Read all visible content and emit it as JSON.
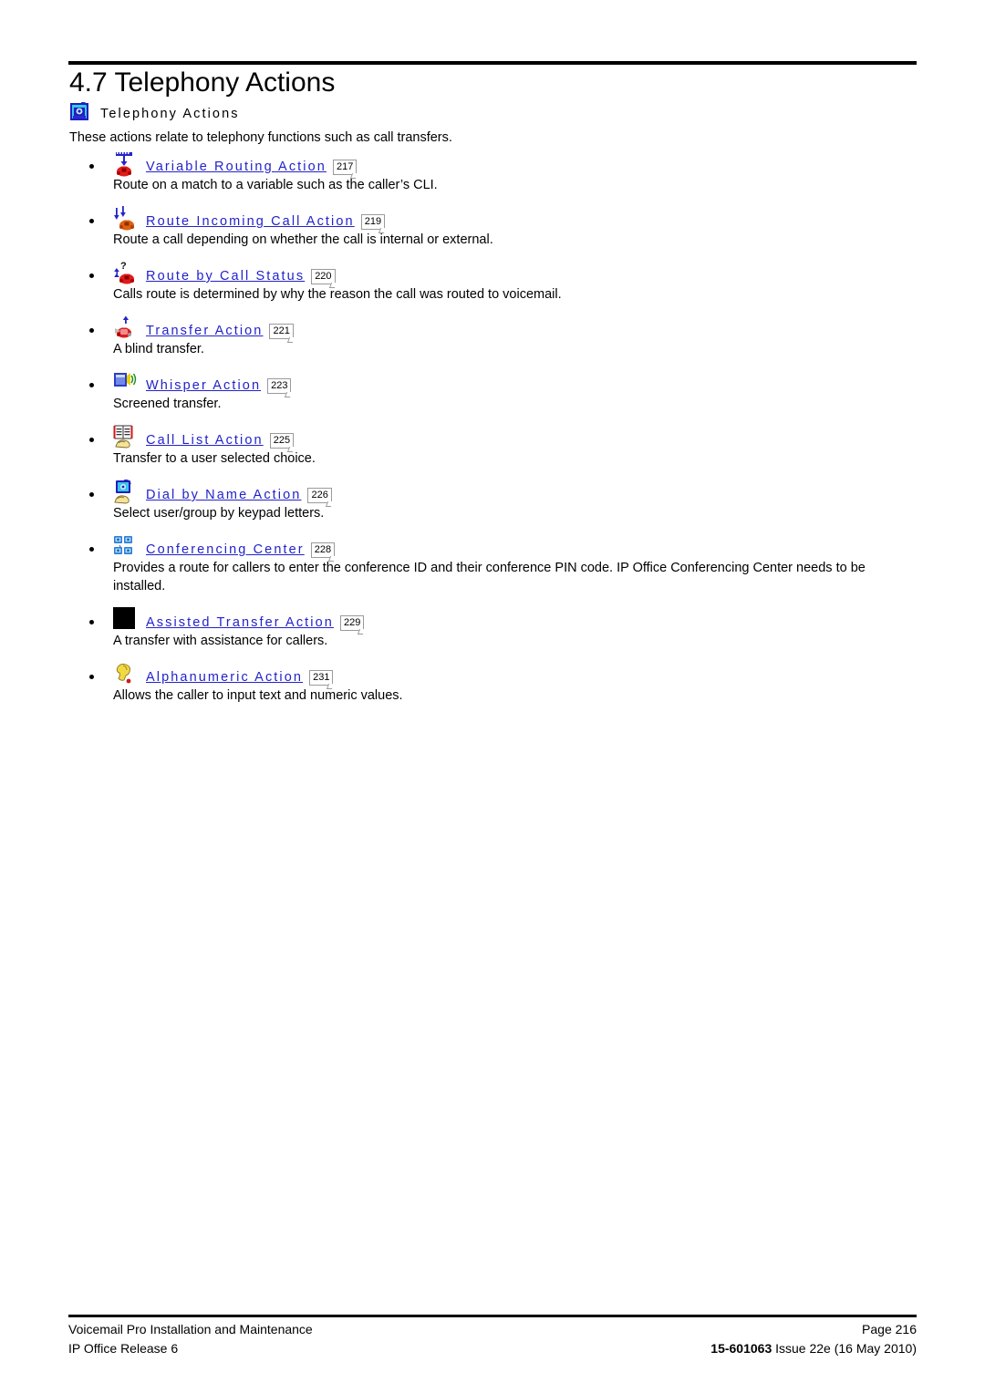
{
  "document": {
    "section_number": "4.7",
    "section_title": "4.7 Telephony Actions",
    "intro_heading": "Telephony Actions",
    "intro_heading_icon": "blue-telephone-icon",
    "intro_text": "These actions relate to telephony functions such as call transfers."
  },
  "actions": [
    {
      "icon": "red-telephone-with-down-arrow-and-ruler-icon",
      "label": "Variable Routing Action",
      "page_ref": "217",
      "description": "Route on a match to a variable such as the caller’s CLI."
    },
    {
      "icon": "blue-arrows-with-orange-telephone-icon",
      "label": "Route Incoming Call Action",
      "page_ref": "219",
      "description": "Route a call depending on whether the call is internal or external."
    },
    {
      "icon": "blue-arrows-question-mark-telephone-icon",
      "label": "Route by Call Status",
      "page_ref": "220",
      "description": "Calls route is determined by why the reason the call was routed to voicemail."
    },
    {
      "icon": "red-telephone-transfer-icon",
      "label": "Transfer Action",
      "page_ref": "221",
      "description": "A blind transfer."
    },
    {
      "icon": "whisper-speaker-icon",
      "label": "Whisper Action",
      "page_ref": "223",
      "description": "Screened transfer."
    },
    {
      "icon": "call-list-book-hand-icon",
      "label": "Call List Action",
      "page_ref": "225",
      "description": "Transfer to a user selected choice."
    },
    {
      "icon": "dial-by-name-telephone-hand-icon",
      "label": "Dial by Name Action",
      "page_ref": "226",
      "description": "Select user/group by keypad letters."
    },
    {
      "icon": "conferencing-four-telephones-icon",
      "label": "Conferencing Center",
      "page_ref": "228",
      "description": "Provides a route for callers to enter the conference ID and their conference PIN code. IP Office Conferencing Center needs to be installed."
    },
    {
      "icon": "missing-image-black-square-icon",
      "label": "Assisted Transfer Action",
      "page_ref": "229",
      "description": "A transfer with assistance for callers."
    },
    {
      "icon": "alphanumeric-yellow-hand-icon",
      "label": "Alphanumeric Action",
      "page_ref": "231",
      "description": "Allows the caller to input text and numeric values."
    }
  ],
  "footer": {
    "left_line1": "Voicemail Pro Installation and Maintenance",
    "left_line2": "IP Office Release 6",
    "right_line1": "Page 216",
    "right_line2_code": "15-601063",
    "right_line2_rest": " Issue 22e (16 May 2010)"
  },
  "colors": {
    "link": "#2222cc",
    "text": "#000000",
    "rule": "#000000"
  }
}
